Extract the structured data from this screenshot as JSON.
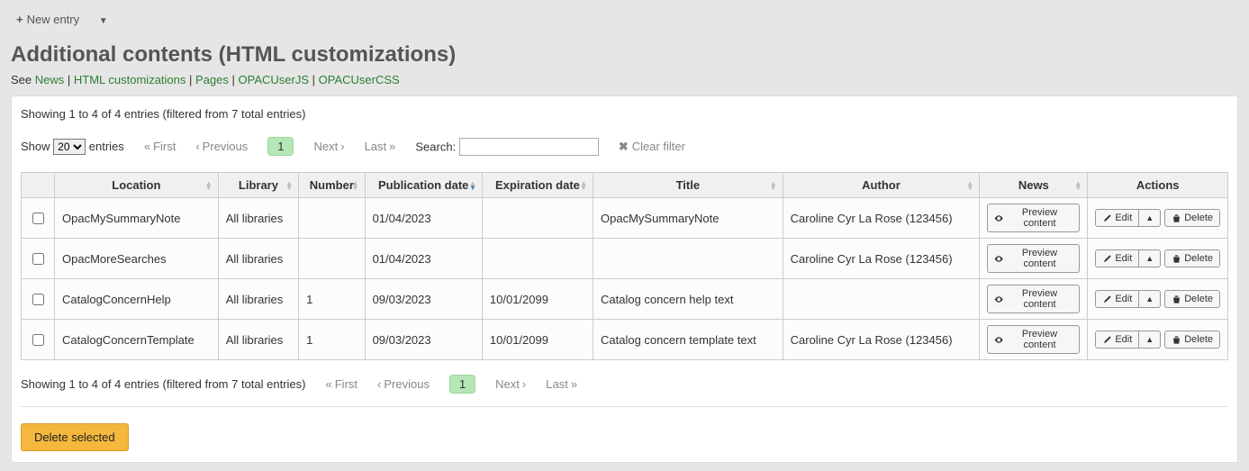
{
  "toolbar": {
    "new_entry_label": "New entry"
  },
  "page_title": "Additional contents (HTML customizations)",
  "see": {
    "prefix": "See ",
    "links": [
      {
        "label": "News"
      },
      {
        "label": "HTML customizations"
      },
      {
        "label": "Pages"
      },
      {
        "label": "OPACUserJS"
      },
      {
        "label": "OPACUserCSS"
      }
    ]
  },
  "table_info_top": "Showing 1 to 4 of 4 entries (filtered from 7 total entries)",
  "table_info_bottom": "Showing 1 to 4 of 4 entries (filtered from 7 total entries)",
  "length_menu": {
    "show_label": "Show",
    "entries_label": "entries",
    "selected": "20"
  },
  "pager": {
    "first": "First",
    "previous": "Previous",
    "current": "1",
    "next": "Next",
    "last": "Last"
  },
  "search": {
    "label": "Search:",
    "value": ""
  },
  "clear_filter": "Clear filter",
  "columns": {
    "location": "Location",
    "library": "Library",
    "number": "Number",
    "publication_date": "Publication date",
    "expiration_date": "Expiration date",
    "title": "Title",
    "author": "Author",
    "news": "News",
    "actions": "Actions"
  },
  "btn": {
    "preview_content": "Preview content",
    "edit": "Edit",
    "delete": "Delete"
  },
  "rows": [
    {
      "location": "OpacMySummaryNote",
      "library": "All libraries",
      "number": "",
      "publication_date": "01/04/2023",
      "expiration_date": "",
      "title": "OpacMySummaryNote",
      "author": "Caroline Cyr La Rose (123456)"
    },
    {
      "location": "OpacMoreSearches",
      "library": "All libraries",
      "number": "",
      "publication_date": "01/04/2023",
      "expiration_date": "",
      "title": "",
      "author": "Caroline Cyr La Rose (123456)"
    },
    {
      "location": "CatalogConcernHelp",
      "library": "All libraries",
      "number": "1",
      "publication_date": "09/03/2023",
      "expiration_date": "10/01/2099",
      "title": "Catalog concern help text",
      "author": ""
    },
    {
      "location": "CatalogConcernTemplate",
      "library": "All libraries",
      "number": "1",
      "publication_date": "09/03/2023",
      "expiration_date": "10/01/2099",
      "title": "Catalog concern template text",
      "author": "Caroline Cyr La Rose (123456)"
    }
  ],
  "delete_selected_label": "Delete selected"
}
